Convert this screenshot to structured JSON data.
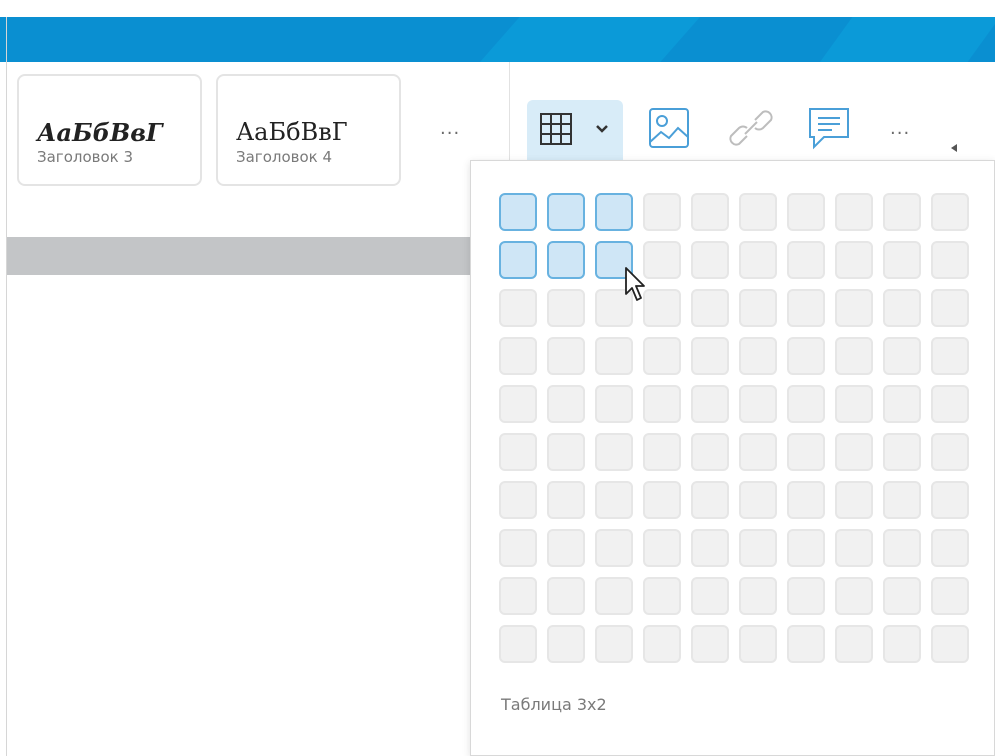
{
  "styles": [
    {
      "sample": "АаБбВвГ",
      "name": "Заголовок 3",
      "bold": true
    },
    {
      "sample": "АаБбВвГ",
      "name": "Заголовок 4",
      "bold": false
    }
  ],
  "more_styles": "...",
  "toolbar": {
    "table_icon": "table-icon",
    "image_icon": "image-icon",
    "link_icon": "link-icon",
    "comment_icon": "comment-icon",
    "more": "..."
  },
  "table_picker": {
    "columns": 10,
    "rows": 10,
    "selected_cols": 3,
    "selected_rows": 2,
    "label": "Таблица 3x2"
  },
  "colors": {
    "accent": "#0a8fd1",
    "cell_selected_fill": "#cfe6f6",
    "cell_selected_border": "#68b2e0",
    "cell_fill": "#f1f1f1"
  }
}
